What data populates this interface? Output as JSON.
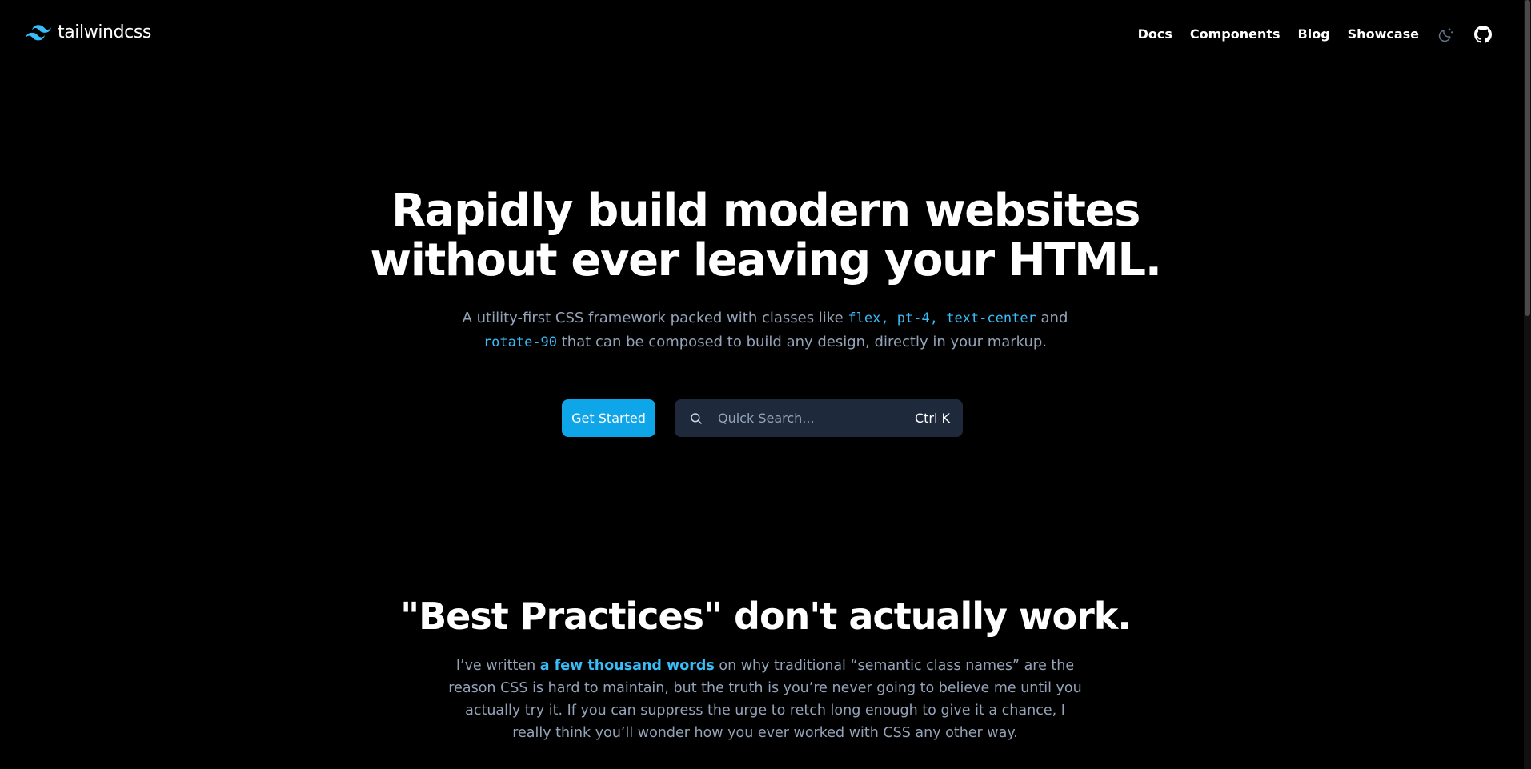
{
  "header": {
    "logo_text": "tailwindcss",
    "nav": [
      {
        "label": "Docs"
      },
      {
        "label": "Components"
      },
      {
        "label": "Blog"
      },
      {
        "label": "Showcase"
      }
    ],
    "icons": [
      "theme-toggle-moon-icon",
      "github-icon"
    ]
  },
  "hero": {
    "title_line1": "Rapidly build modern websites",
    "title_line2": "without ever leaving your HTML.",
    "sub_part1": "A utility-first CSS framework packed with classes like ",
    "code1": "flex, pt-4, text-center",
    "sub_part2": " and",
    "code2": "rotate-90",
    "sub_part3": " that can be composed to build any design, directly in your markup.",
    "cta_label": "Get Started",
    "search_placeholder": "Quick Search...",
    "search_shortcut": "Ctrl K"
  },
  "section": {
    "title": "\"Best Practices\" don't actually work.",
    "body_part1": "I’ve written ",
    "link_text": "a few thousand words",
    "body_part2": " on why traditional “semantic class names” are the reason CSS is hard to maintain, but the truth is you’re never going to believe me until you actually try it. If you can suppress the urge to retch long enough to give it a chance, I really think you’ll wonder how you ever worked with CSS any other way."
  },
  "colors": {
    "background": "#000000",
    "accent": "#0ea5e9",
    "code_accent": "#38bdf8",
    "muted_text": "#94a3b8",
    "search_bg": "#1e293b"
  }
}
